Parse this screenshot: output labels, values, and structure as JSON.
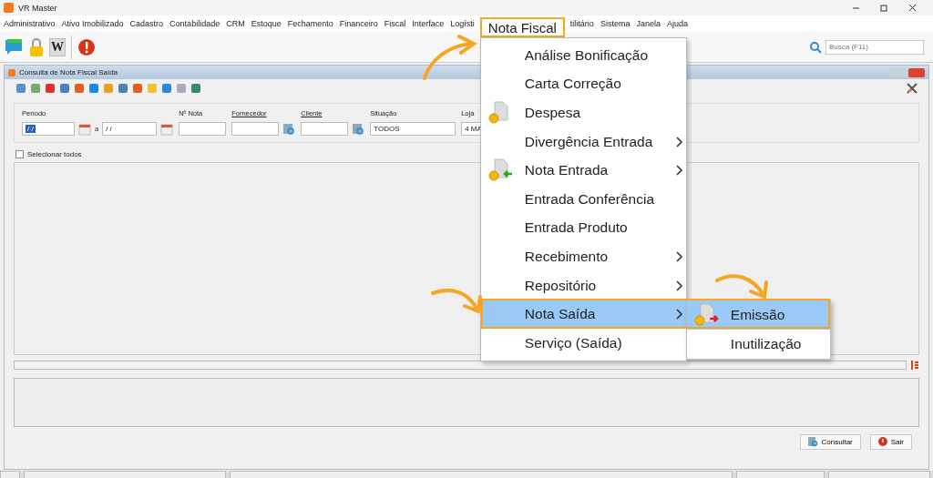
{
  "window": {
    "title": "VR Master"
  },
  "menu_bar": [
    {
      "label": "Administrativo",
      "selected": false
    },
    {
      "label": "Ativo Imobilizado",
      "selected": false
    },
    {
      "label": "Cadastro",
      "selected": false
    },
    {
      "label": "Contabilidade",
      "selected": false
    },
    {
      "label": "CRM",
      "selected": false
    },
    {
      "label": "Estoque",
      "selected": false
    },
    {
      "label": "Fechamento",
      "selected": false
    },
    {
      "label": "Financeiro",
      "selected": false
    },
    {
      "label": "Fiscal",
      "selected": false
    },
    {
      "label": "Interface",
      "selected": false
    },
    {
      "label": "Logísti",
      "selected": false
    },
    {
      "label": "Nota Fiscal",
      "selected": true
    },
    {
      "label": "tilitário",
      "selected": false
    },
    {
      "label": "Sistema",
      "selected": false
    },
    {
      "label": "Janela",
      "selected": false
    },
    {
      "label": "Ajuda",
      "selected": false
    }
  ],
  "toolbar": {
    "w_label": "W",
    "search": {
      "placeholder": "Busca (F11)"
    }
  },
  "dropdown": [
    {
      "label": "Análise Bonificação",
      "kind": "plain",
      "has_submenu": false,
      "selected": false
    },
    {
      "label": "Carta Correção",
      "kind": "plain",
      "has_submenu": false,
      "selected": false
    },
    {
      "label": "Despesa",
      "kind": "coin-doc",
      "has_submenu": false,
      "selected": false
    },
    {
      "label": "Divergência Entrada",
      "kind": "plain",
      "has_submenu": true,
      "selected": false
    },
    {
      "label": "Nota Entrada",
      "kind": "coin-doc-in",
      "has_submenu": true,
      "selected": false
    },
    {
      "label": "Entrada Conferência",
      "kind": "plain",
      "has_submenu": false,
      "selected": false
    },
    {
      "label": "Entrada Produto",
      "kind": "plain",
      "has_submenu": false,
      "selected": false
    },
    {
      "label": "Recebimento",
      "kind": "plain",
      "has_submenu": true,
      "selected": false
    },
    {
      "label": "Repositório",
      "kind": "plain",
      "has_submenu": true,
      "selected": false
    },
    {
      "label": "Nota Saída",
      "kind": "plain",
      "has_submenu": true,
      "selected": true
    },
    {
      "label": "Serviço (Saída)",
      "kind": "plain",
      "has_submenu": false,
      "selected": false
    }
  ],
  "submenu": [
    {
      "label": "Emissão",
      "kind": "coin-doc-out",
      "selected": true
    },
    {
      "label": "Inutilização",
      "kind": "plain",
      "selected": false
    }
  ],
  "internal_window": {
    "title": "Consulta de Nota Fiscal Saída",
    "filters": {
      "period_label": "Período",
      "period_from": {
        "value": "/ /",
        "selected": true
      },
      "period_sep": "a",
      "period_to": {
        "value": "/ /",
        "selected": false
      },
      "nota_label": "Nº Nota",
      "fornecedor_label": "Fornecedor",
      "cliente_label": "Cliente",
      "situacao_label": "Situação",
      "situacao_value": "TODOS",
      "loja_label": "Loja",
      "loja_value": "4 MA"
    },
    "select_all": {
      "label": "Selecionar todos",
      "checked": false
    },
    "buttons": [
      {
        "label": "Consultar",
        "kind": "search"
      },
      {
        "label": "Sair",
        "kind": "exit"
      }
    ]
  }
}
